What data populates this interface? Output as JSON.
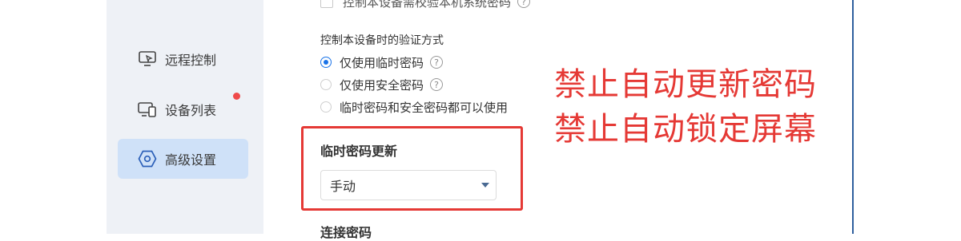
{
  "sidebar": {
    "items": [
      {
        "label": "远程控制",
        "icon": "remote-control-icon",
        "active": false,
        "badge": false
      },
      {
        "label": "设备列表",
        "icon": "device-list-icon",
        "active": false,
        "badge": true
      },
      {
        "label": "高级设置",
        "icon": "settings-hexagon-icon",
        "active": true,
        "badge": false
      }
    ]
  },
  "main": {
    "top_checkbox_label": "控制本设备需校验本机系统密码",
    "help_glyph": "?",
    "verify_section_title": "控制本设备时的验证方式",
    "verify_options": [
      {
        "label": "仅使用临时密码",
        "checked": true,
        "help": true
      },
      {
        "label": "仅使用安全密码",
        "checked": false,
        "help": true
      },
      {
        "label": "临时密码和安全密码都可以使用",
        "checked": false,
        "help": false
      }
    ],
    "temp_password_update_title": "临时密码更新",
    "temp_password_update_value": "手动",
    "connection_password_title": "连接密码"
  },
  "annotations": [
    "禁止自动更新密码",
    "禁止自动锁定屏幕"
  ],
  "colors": {
    "accent": "#1a73e8",
    "annotation_red": "#e53935",
    "sidebar_bg": "#eef1f6",
    "sidebar_active_bg": "#cfe1f8",
    "badge_red": "#ef4a4a"
  }
}
